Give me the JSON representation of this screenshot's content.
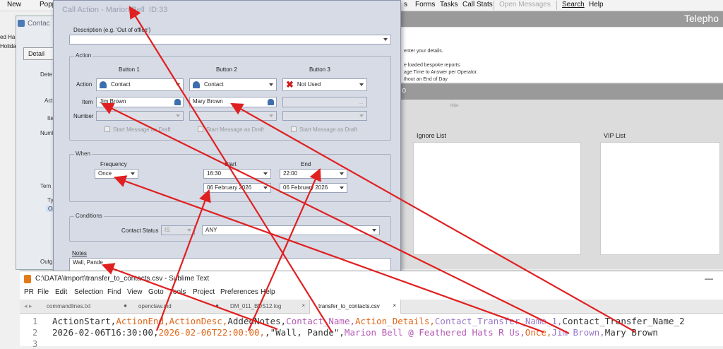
{
  "appbar": {
    "left": [
      "New",
      "Popp"
    ],
    "right": [
      "s",
      "Forms",
      "Tasks",
      "Call Stats",
      "Open Messages",
      "Search",
      "Help"
    ]
  },
  "background": {
    "telephone_title": "Telepho",
    "info_lines": [
      "enter your details.",
      "e loaded bespoke reports:",
      "age Time to Answer per Operator.",
      "thout an End of Day"
    ],
    "midbar_text": "o",
    "faint_text": "Hide",
    "ignore_list": "Ignore List",
    "vip_list": "VIP List",
    "left_text": [
      "ed Ha",
      "Holida"
    ]
  },
  "contact_window": {
    "title": "Contac",
    "tab": "Detail",
    "labels": [
      "Dete",
      "Actio",
      "Ite",
      "Numb",
      "Tem",
      "Ty",
      "On",
      "Outg"
    ]
  },
  "dialog": {
    "title": "Call Action - Marion Bell",
    "id": "ID:33",
    "description_label": "Description (e.g. 'Out of office')",
    "action_group": "Action",
    "button_headers": [
      "Button 1",
      "Button 2",
      "Button 3"
    ],
    "row_labels": {
      "action": "Action",
      "item": "Item",
      "number": "Number"
    },
    "actions": [
      "Contact",
      "Contact",
      "Not Used"
    ],
    "items": [
      "Jim Brown",
      "Mary Brown",
      ""
    ],
    "draft_label": "Start Message as Draft",
    "when_group": "When",
    "frequency_label": "Frequency",
    "frequency_value": "Once",
    "start_label": "Start",
    "end_label": "End",
    "start_time": "16:30",
    "end_time": "22:00",
    "start_date": "06 February 2026",
    "end_date": "06 February 2026",
    "conditions_group": "Conditions",
    "contact_status_label": "Contact Status",
    "contact_status_op": "IS",
    "contact_status_value": "ANY",
    "notes_label": "Notes",
    "notes_value": "Wall, Pande"
  },
  "sublime": {
    "title": "C:\\DATA\\Import\\transfer_to_contacts.csv - Sublime Text",
    "menu": [
      "PR",
      "File",
      "Edit",
      "Selection",
      "Find",
      "View",
      "Goto",
      "Tools",
      "Project",
      "Preferences",
      "Help"
    ],
    "tabs": [
      "commandlines.txt",
      "openclaw.md",
      "DM_011_BDS12.log",
      "transfer_to_contacts.csv"
    ],
    "line_numbers": [
      "1",
      "2",
      "3"
    ],
    "line1": [
      {
        "t": "ActionStart,",
        "c": "gray"
      },
      {
        "t": "ActionEnd,",
        "c": "orange"
      },
      {
        "t": "ActionDesc,",
        "c": "orange"
      },
      {
        "t": "AddedNotes,",
        "c": "gray"
      },
      {
        "t": "Contact_Name,",
        "c": "pink"
      },
      {
        "t": "Action_Details,",
        "c": "orange"
      },
      {
        "t": "Contact_Transfer_Name_1,",
        "c": "purple"
      },
      {
        "t": "Contact_Transfer_Name_2",
        "c": "gray"
      }
    ],
    "line2": [
      {
        "t": "2026-02-06T16:30:00,",
        "c": "gray"
      },
      {
        "t": "2026-02-06T22:00:00,",
        "c": "orange"
      },
      {
        "t": ",",
        "c": "gray"
      },
      {
        "t": "\"Wall, Pande\",",
        "c": "gray"
      },
      {
        "t": "Marion Bell @ Feathered Hats R Us,",
        "c": "pink"
      },
      {
        "t": "Once,",
        "c": "orange"
      },
      {
        "t": "Jim Brown,",
        "c": "purple"
      },
      {
        "t": "Mary Brown",
        "c": "gray"
      }
    ]
  },
  "colors": {
    "annotation": "#e02020",
    "dialog_bg": "#d6dbe6"
  }
}
